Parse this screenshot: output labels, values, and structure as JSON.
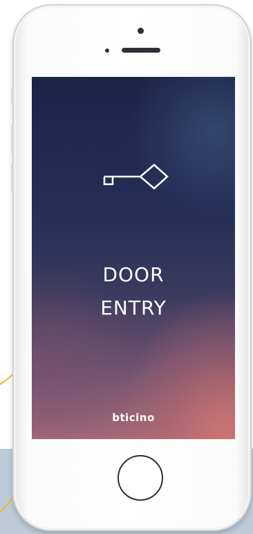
{
  "app": {
    "title_line1": "DOOR",
    "title_line2": "ENTRY",
    "brand": "bticino",
    "icon": "key-icon"
  },
  "colors": {
    "accent_curve": "#f1b62b",
    "screen_top": "#1c2548",
    "screen_bottom": "#a76a78"
  }
}
